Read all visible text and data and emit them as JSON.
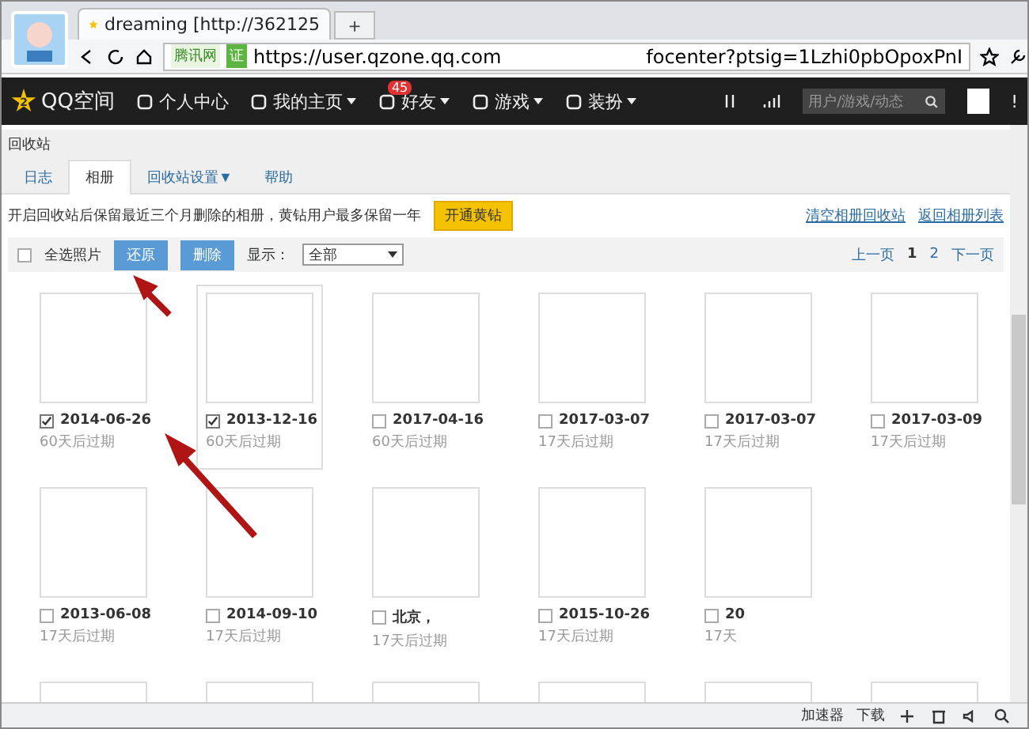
{
  "browser": {
    "tab_title": "dreaming [http://362125",
    "new_tab": "+",
    "site_badge": "腾讯网",
    "cert_badge": "证",
    "url_start": "https://user.qzone.qq.com",
    "url_end": "focenter?ptsig=1Lzhi0pbOpoxPnI"
  },
  "nav": {
    "logo": "QQ空间",
    "logo_level": "2",
    "items": [
      {
        "label": "个人中心",
        "dropdown": false
      },
      {
        "label": "我的主页",
        "dropdown": true
      },
      {
        "label": "好友",
        "dropdown": true,
        "badge": "45"
      },
      {
        "label": "游戏",
        "dropdown": true
      },
      {
        "label": "装扮",
        "dropdown": true
      }
    ],
    "search_placeholder": "用户/游戏/动态",
    "extra": "!"
  },
  "section_title": "回收站",
  "tabs": [
    {
      "label": "日志",
      "selected": false
    },
    {
      "label": "相册",
      "selected": true
    },
    {
      "label": "回收站设置▼",
      "selected": false
    },
    {
      "label": "帮助",
      "selected": false
    }
  ],
  "notice": "开启回收站后保留最近三个月删除的相册，黄钻用户最多保留一年",
  "vip_button": "开通黄钻",
  "links": [
    "清空相册回收站",
    "返回相册列表"
  ],
  "toolbar": {
    "select_all": "全选照片",
    "select_all_checked": false,
    "restore": "还原",
    "delete": "删除",
    "show_label": "显示：",
    "show_value": "全部",
    "prev": "上一页",
    "pages": [
      {
        "label": "1",
        "selected": true
      },
      {
        "label": "2",
        "selected": false
      }
    ],
    "next": "下一页"
  },
  "albums": [
    {
      "name": "2014-06-26",
      "expires": "60天后过期",
      "checked": true,
      "hovered": false
    },
    {
      "name": "2013-12-16",
      "expires": "60天后过期",
      "checked": true,
      "hovered": true
    },
    {
      "name": "2017-04-16",
      "expires": "60天后过期",
      "checked": false,
      "hovered": false
    },
    {
      "name": "2017-03-07",
      "expires": "17天后过期",
      "checked": false,
      "hovered": false
    },
    {
      "name": "2017-03-07",
      "expires": "17天后过期",
      "checked": false,
      "hovered": false
    },
    {
      "name": "2017-03-09",
      "expires": "17天后过期",
      "checked": false,
      "hovered": false
    },
    {
      "name": "2013-06-08",
      "expires": "17天后过期",
      "checked": false,
      "hovered": false
    },
    {
      "name": "2014-09-10",
      "expires": "17天后过期",
      "checked": false,
      "hovered": false
    },
    {
      "name": "北京，",
      "expires": "17天后过期",
      "checked": false,
      "hovered": false
    },
    {
      "name": "2015-10-26",
      "expires": "17天后过期",
      "checked": false,
      "hovered": false
    },
    {
      "name": "20",
      "expires": "17天",
      "checked": false,
      "hovered": false
    }
  ],
  "status_bar": {
    "accelerator": "加速器",
    "download": "下载"
  }
}
